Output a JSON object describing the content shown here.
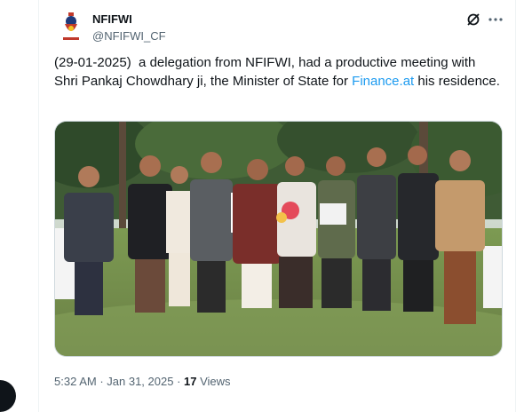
{
  "author": {
    "display_name": "NFIFWI",
    "handle": "@NFIFWI_CF",
    "avatar_icon": "nfifwi-logo-icon"
  },
  "actions": {
    "grok_icon": "grok-icon",
    "more_icon": "more-dots-icon"
  },
  "tweet": {
    "text_part1": "(29-01-2025)  a delegation from NFIFWI, had a productive meeting with Shri Pankaj Chowdhary ji, the Minister of State for ",
    "link": "Finance.at",
    "text_part2": " his residence."
  },
  "media": {
    "type": "photo",
    "subject": "group-photo-delegation"
  },
  "meta": {
    "time": "5:32 AM",
    "separator1": " · ",
    "date": "Jan 31, 2025",
    "separator2": " · ",
    "views_count": "17",
    "views_label": " Views"
  },
  "colors": {
    "text": "#0f1419",
    "secondary": "#536471",
    "link": "#1d9bf0",
    "border": "#eff3f4"
  }
}
